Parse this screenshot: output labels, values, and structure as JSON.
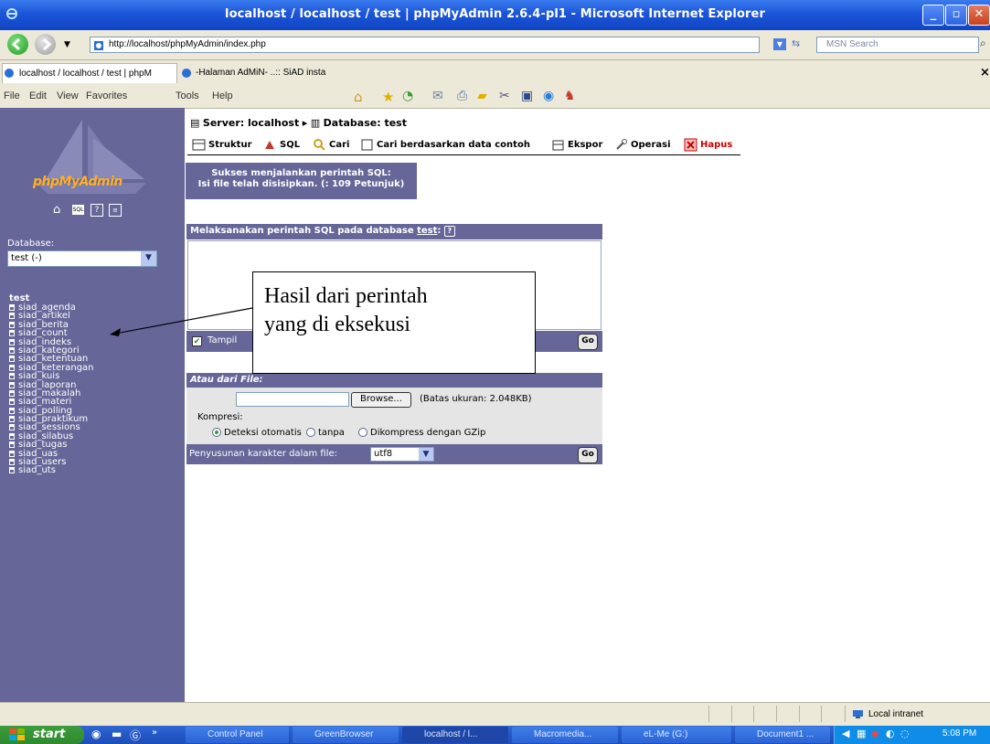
{
  "window": {
    "title": "localhost / localhost / test | phpMyAdmin 2.6.4-pl1 - Microsoft Internet Explorer"
  },
  "address": {
    "url": "http://localhost/phpMyAdmin/index.php",
    "search_placeholder": "MSN Search"
  },
  "tabs": [
    {
      "label": "localhost / localhost / test | phpM"
    },
    {
      "label": "-Halaman AdMiN- ..:: SiAD insta"
    }
  ],
  "menu": [
    "File",
    "Edit",
    "View",
    "Favorites",
    "Tools",
    "Help"
  ],
  "left": {
    "logo": "phpMyAdmin",
    "database_label": "Database:",
    "database_value": "test (-)",
    "db_name": "test",
    "tables": [
      "siad_agenda",
      "siad_artikel",
      "siad_berita",
      "siad_count",
      "siad_indeks",
      "siad_kategori",
      "siad_ketentuan",
      "siad_keterangan",
      "siad_kuis",
      "siad_laporan",
      "siad_makalah",
      "siad_materi",
      "siad_polling",
      "siad_praktikum",
      "siad_sessions",
      "siad_silabus",
      "siad_tugas",
      "siad_uas",
      "siad_users",
      "siad_uts"
    ]
  },
  "breadcrumb": {
    "server": "Server: localhost",
    "database": "Database: test"
  },
  "db_tabs": [
    "Struktur",
    "SQL",
    "Cari",
    "Cari berdasarkan data contoh",
    "Ekspor",
    "Operasi",
    "Hapus"
  ],
  "success": {
    "line1": "Sukses menjalankan perintah SQL:",
    "line2": "Isi file telah disisipkan. (: 109 Petunjuk)"
  },
  "sql": {
    "heading": "Melaksanakan perintah SQL pada database ",
    "db_link": "test",
    "show_label": "Tampil",
    "go": "Go"
  },
  "file": {
    "heading": "Atau dari File:",
    "browse": "Browse...",
    "limit": "(Batas ukuran: 2.048KB)",
    "compression_label": "Kompresi:",
    "options": [
      "Deteksi otomatis",
      "tanpa",
      "Dikompress dengan GZip"
    ],
    "selected_option": "Deteksi otomatis",
    "charset_label": "Penyusunan karakter dalam file:",
    "charset_value": "utf8",
    "go": "Go"
  },
  "annotation": {
    "line1": "Hasil dari perintah",
    "line2": "yang di eksekusi"
  },
  "status": {
    "zone": "Local intranet"
  },
  "taskbar": {
    "start": "start",
    "items": [
      "Control Panel",
      "GreenBrowser",
      "localhost / l...",
      "Macromedia...",
      "eL-Me (G:)",
      "Document1 ..."
    ],
    "clock": "5:08 PM"
  },
  "colors": {
    "pma_panel": "#666699",
    "title_bar": "#1c55d8",
    "chrome": "#ece9d8"
  }
}
